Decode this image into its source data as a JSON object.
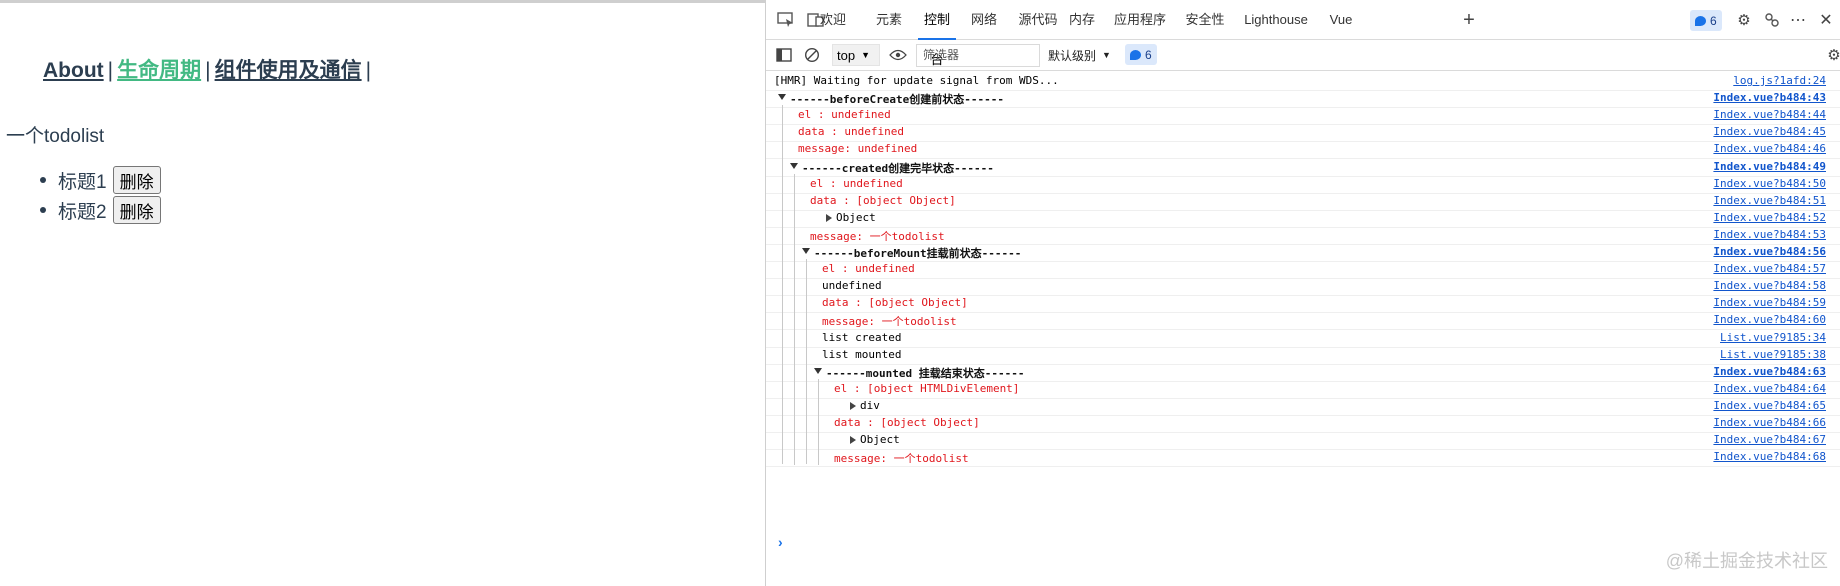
{
  "page": {
    "nav": {
      "about": "About",
      "lifecycle": "生命周期",
      "components": "组件使用及通信",
      "separator": "|"
    },
    "todo_title": "一个todolist",
    "todos": [
      {
        "title": "标题1",
        "delete_label": "删除"
      },
      {
        "title": "标题2",
        "delete_label": "删除"
      }
    ]
  },
  "devtools": {
    "tabs": [
      "欢迎",
      "元素",
      "控制台",
      "网络",
      "源代码",
      "内存",
      "应用程序",
      "安全性",
      "Lighthouse",
      "Vue"
    ],
    "active_tab": "控制台",
    "issue_count": "6",
    "toolbar": {
      "context": "top",
      "filter_placeholder": "筛选器",
      "level": "默认级别",
      "issue_count": "6"
    },
    "console_rows": [
      {
        "text": "[HMR] Waiting for update signal from WDS...",
        "src": "log.js?1afd:24",
        "style": "plain",
        "indent": 0
      },
      {
        "text": "------beforeCreate创建前状态------",
        "src": "Index.vue?b484:43",
        "style": "group",
        "indent": 0
      },
      {
        "text": "el     : undefined",
        "src": "Index.vue?b484:44",
        "style": "red",
        "indent": 1
      },
      {
        "text": "data   : undefined",
        "src": "Index.vue?b484:45",
        "style": "red",
        "indent": 1
      },
      {
        "text": "message: undefined",
        "src": "Index.vue?b484:46",
        "style": "red",
        "indent": 1
      },
      {
        "text": "------created创建完毕状态------",
        "src": "Index.vue?b484:49",
        "style": "group",
        "indent": 1
      },
      {
        "text": "el     : undefined",
        "src": "Index.vue?b484:50",
        "style": "red",
        "indent": 2
      },
      {
        "text": "data   : [object Object]",
        "src": "Index.vue?b484:51",
        "style": "red",
        "indent": 2
      },
      {
        "text": "Object",
        "src": "Index.vue?b484:52",
        "style": "object",
        "indent": 2
      },
      {
        "text": "message: 一个todolist",
        "src": "Index.vue?b484:53",
        "style": "red",
        "indent": 2
      },
      {
        "text": "------beforeMount挂载前状态------",
        "src": "Index.vue?b484:56",
        "style": "group",
        "indent": 2
      },
      {
        "text": "el     : undefined",
        "src": "Index.vue?b484:57",
        "style": "red",
        "indent": 3
      },
      {
        "text": "undefined",
        "src": "Index.vue?b484:58",
        "style": "plain",
        "indent": 3
      },
      {
        "text": "data   : [object Object]",
        "src": "Index.vue?b484:59",
        "style": "red",
        "indent": 3
      },
      {
        "text": "message: 一个todolist",
        "src": "Index.vue?b484:60",
        "style": "red",
        "indent": 3
      },
      {
        "text": "list created",
        "src": "List.vue?9185:34",
        "style": "plain",
        "indent": 3
      },
      {
        "text": "list mounted",
        "src": "List.vue?9185:38",
        "style": "plain",
        "indent": 3
      },
      {
        "text": "------mounted 挂载结束状态------",
        "src": "Index.vue?b484:63",
        "style": "group",
        "indent": 3
      },
      {
        "text": "el     : [object HTMLDivElement]",
        "src": "Index.vue?b484:64",
        "style": "red",
        "indent": 4
      },
      {
        "text": "div",
        "src": "Index.vue?b484:65",
        "style": "object",
        "indent": 4
      },
      {
        "text": "data   : [object Object]",
        "src": "Index.vue?b484:66",
        "style": "red",
        "indent": 4
      },
      {
        "text": "Object",
        "src": "Index.vue?b484:67",
        "style": "object",
        "indent": 4
      },
      {
        "text": "message: 一个todolist",
        "src": "Index.vue?b484:68",
        "style": "red",
        "indent": 4
      }
    ],
    "prompt": "›"
  },
  "watermark": "@稀土掘金技术社区",
  "colors": {
    "link_active": "#42b983",
    "text": "#2c3e50",
    "console_error_text": "#e0161c",
    "devtools_accent": "#1a73e8"
  },
  "icons": [
    "inspect-icon",
    "device-toolbar-icon",
    "add-tab-icon",
    "issues-icon",
    "settings-icon",
    "remote-icon",
    "more-icon",
    "close-icon",
    "sidebar-toggle-icon",
    "clear-console-icon",
    "eye-icon",
    "console-settings-icon"
  ]
}
